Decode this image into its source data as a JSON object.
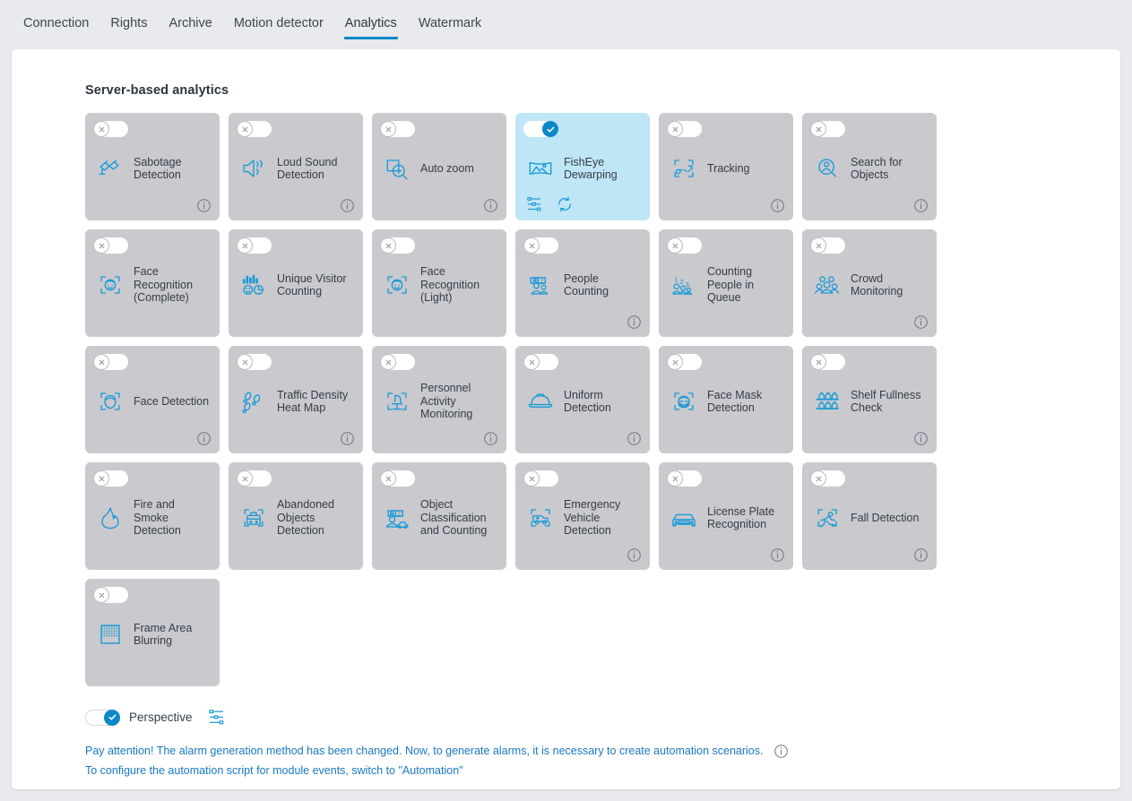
{
  "tabs": [
    {
      "label": "Connection",
      "active": false
    },
    {
      "label": "Rights",
      "active": false
    },
    {
      "label": "Archive",
      "active": false
    },
    {
      "label": "Motion detector",
      "active": false
    },
    {
      "label": "Analytics",
      "active": true
    },
    {
      "label": "Watermark",
      "active": false
    }
  ],
  "section": {
    "title": "Server-based analytics"
  },
  "colors": {
    "accent": "#0b88c8",
    "icon_blue": "#1a9bd7",
    "card_bg": "#c9c9ce",
    "card_bg_active": "#bfe6f6",
    "page_bg": "#e8eaed",
    "link": "#1a78c2"
  },
  "cards": [
    {
      "label": "Sabotage Detection",
      "icon": "sabotage-camera-icon",
      "enabled": false,
      "info": true
    },
    {
      "label": "Loud Sound Detection",
      "icon": "loud-speaker-icon",
      "enabled": false,
      "info": true
    },
    {
      "label": "Auto zoom",
      "icon": "magnifier-plus-icon",
      "enabled": false,
      "info": true
    },
    {
      "label": "FishEye Dewarping",
      "icon": "fisheye-panorama-icon",
      "enabled": true,
      "info": false,
      "actions": [
        "settings-sliders-icon",
        "refresh-icon"
      ]
    },
    {
      "label": "Tracking",
      "icon": "tracking-path-icon",
      "enabled": false,
      "info": true
    },
    {
      "label": "Search for Objects",
      "icon": "person-magnifier-icon",
      "enabled": false,
      "info": true
    },
    {
      "label": "Face Recognition (Complete)",
      "icon": "face-frame-icon",
      "enabled": false,
      "info": false
    },
    {
      "label": "Unique Visitor Counting",
      "icon": "bars-face-pie-icon",
      "enabled": false,
      "info": false
    },
    {
      "label": "Face Recognition (Light)",
      "icon": "face-frame-icon",
      "enabled": false,
      "info": false
    },
    {
      "label": "People Counting",
      "icon": "people-counting-icon",
      "enabled": false,
      "info": true
    },
    {
      "label": "Counting People in Queue",
      "icon": "queue-numbers-icon",
      "enabled": false,
      "info": false
    },
    {
      "label": "Crowd Monitoring",
      "icon": "crowd-icon",
      "enabled": false,
      "info": true
    },
    {
      "label": "Face Detection",
      "icon": "face-detect-frame-icon",
      "enabled": false,
      "info": true
    },
    {
      "label": "Traffic Density Heat Map",
      "icon": "footsteps-icon",
      "enabled": false,
      "info": true
    },
    {
      "label": "Personnel Activity Monitoring",
      "icon": "chair-frame-icon",
      "enabled": false,
      "info": true
    },
    {
      "label": "Uniform Detection",
      "icon": "helmet-icon",
      "enabled": false,
      "info": true
    },
    {
      "label": "Face Mask Detection",
      "icon": "face-mask-frame-icon",
      "enabled": false,
      "info": false
    },
    {
      "label": "Shelf Fullness Check",
      "icon": "shelf-bottles-icon",
      "enabled": false,
      "info": true
    },
    {
      "label": "Fire and Smoke Detection",
      "icon": "flame-icon",
      "enabled": false,
      "info": false
    },
    {
      "label": "Abandoned Objects Detection",
      "icon": "suitcase-frame-icon",
      "enabled": false,
      "info": false
    },
    {
      "label": "Object Classification and Counting",
      "icon": "object-classify-icon",
      "enabled": false,
      "info": false
    },
    {
      "label": "Emergency Vehicle Detection",
      "icon": "ambulance-frame-icon",
      "enabled": false,
      "info": true
    },
    {
      "label": "License Plate Recognition",
      "icon": "car-plate-icon",
      "enabled": false,
      "info": true
    },
    {
      "label": "Fall Detection",
      "icon": "fall-person-frame-icon",
      "enabled": false,
      "info": true
    },
    {
      "label": "Frame Area Blurring",
      "icon": "blur-area-icon",
      "enabled": false,
      "info": false
    }
  ],
  "perspective": {
    "label": "Perspective",
    "enabled": true,
    "settings_icon": "settings-sliders-icon"
  },
  "notice": {
    "line1": "Pay attention! The alarm generation method has been changed. Now, to generate alarms, it is necessary to create automation scenarios.",
    "line2": "To configure the automation script for module events, switch to \"Automation\"",
    "info_icon": "info-icon"
  }
}
